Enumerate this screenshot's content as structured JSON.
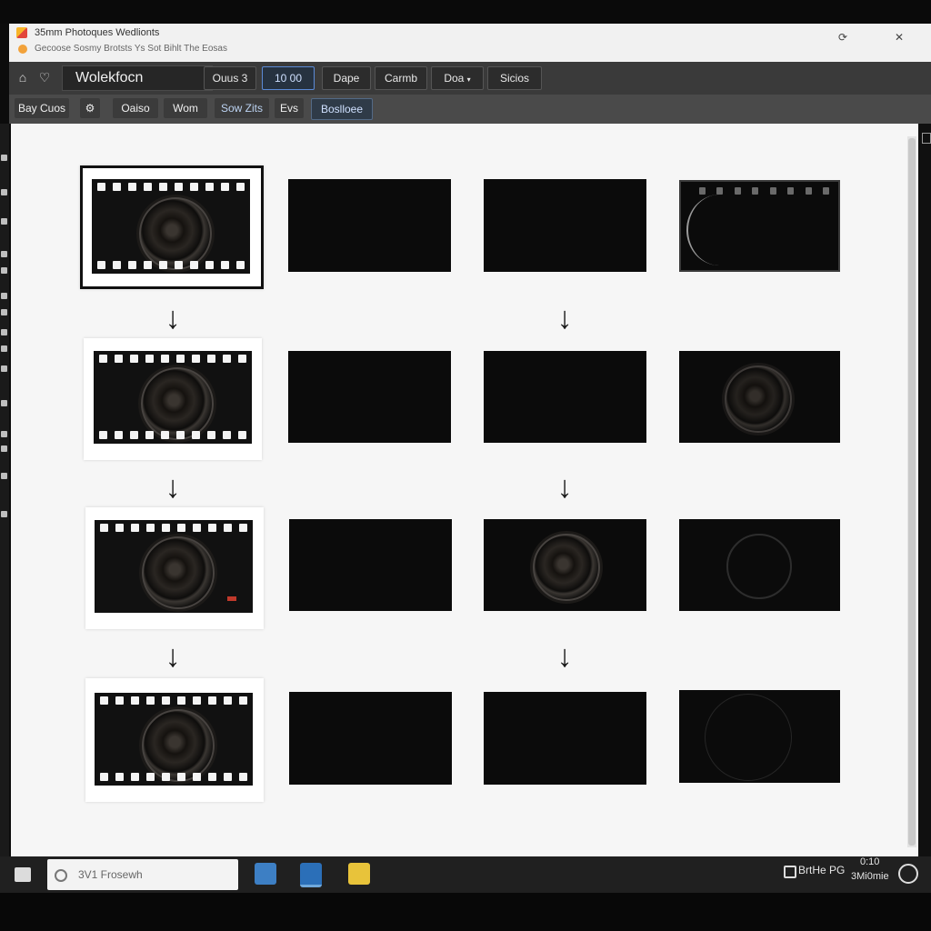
{
  "window": {
    "title": "35mm Photoques Wedlionts",
    "subtitle": "Gecoose Sosmy Brotsts  Ys Sot Bihlt The Eosas"
  },
  "menubar": {
    "app_name": "Wolekfocn",
    "items": [
      "Ouus 3",
      "10 00",
      "Dape",
      "Carmb",
      "Doa",
      "Sicios"
    ]
  },
  "toolbar": {
    "items": [
      "Bay Cuos",
      "Oaiso",
      "Wom",
      "Sow Zits",
      "Evs",
      "Boslloee"
    ]
  },
  "taskbar": {
    "search_placeholder": "3V1 Frosewh",
    "tray_text": "BrtHe PG",
    "clock_line1": "0:10",
    "clock_line2": "3Mi0mie"
  },
  "colors": {
    "canvas": "#f6f6f6",
    "frame": "#0b0b0b",
    "accent": "#5b8ad6"
  }
}
